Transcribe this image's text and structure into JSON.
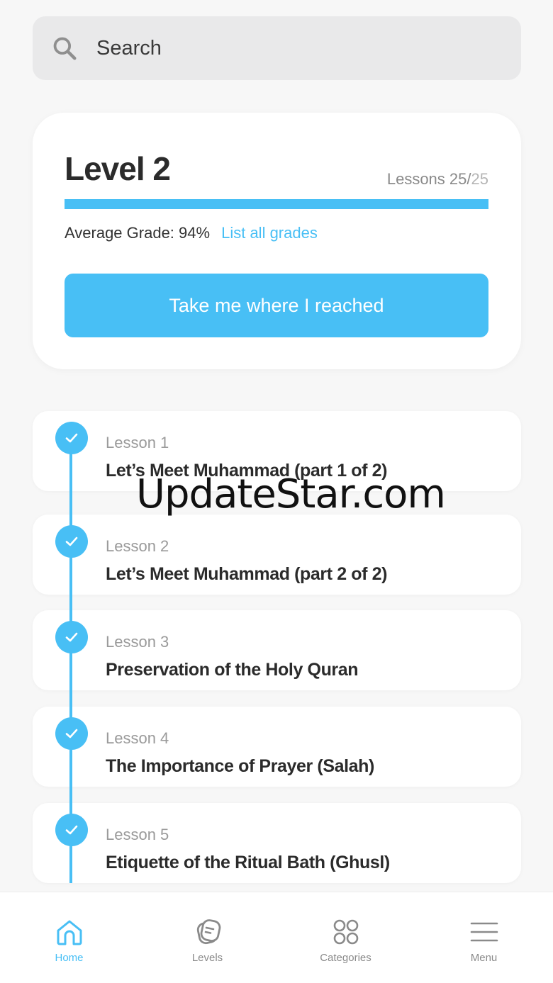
{
  "search": {
    "placeholder": "Search"
  },
  "level_card": {
    "title": "Level 2",
    "lessons_label": "Lessons",
    "lessons_completed": "25/",
    "lessons_total": "25",
    "progress": 1.0,
    "average_grade_label": "Average Grade:",
    "average_grade_value": "94%",
    "list_grades_link": "List all grades",
    "cta_label": "Take me where I reached"
  },
  "lessons": [
    {
      "number": "Lesson 1",
      "title": "Let’s Meet Muhammad (part 1 of 2)",
      "completed": true
    },
    {
      "number": "Lesson 2",
      "title": "Let’s Meet Muhammad (part 2 of 2)",
      "completed": true
    },
    {
      "number": "Lesson 3",
      "title": "Preservation of the Holy Quran",
      "completed": true
    },
    {
      "number": "Lesson 4",
      "title": "The Importance of Prayer (Salah)",
      "completed": true
    },
    {
      "number": "Lesson 5",
      "title": "Etiquette of the Ritual Bath (Ghusl)",
      "completed": true
    }
  ],
  "watermark": "UpdateStar.com",
  "bottom_nav": {
    "items": [
      {
        "label": "Home",
        "icon": "home-icon",
        "active": true
      },
      {
        "label": "Levels",
        "icon": "levels-icon",
        "active": false
      },
      {
        "label": "Categories",
        "icon": "categories-icon",
        "active": false
      },
      {
        "label": "Menu",
        "icon": "menu-icon",
        "active": false
      }
    ]
  },
  "colors": {
    "accent": "#48bff5",
    "text": "#2b2b2b",
    "muted": "#8a8a8a",
    "background": "#f7f7f7"
  }
}
